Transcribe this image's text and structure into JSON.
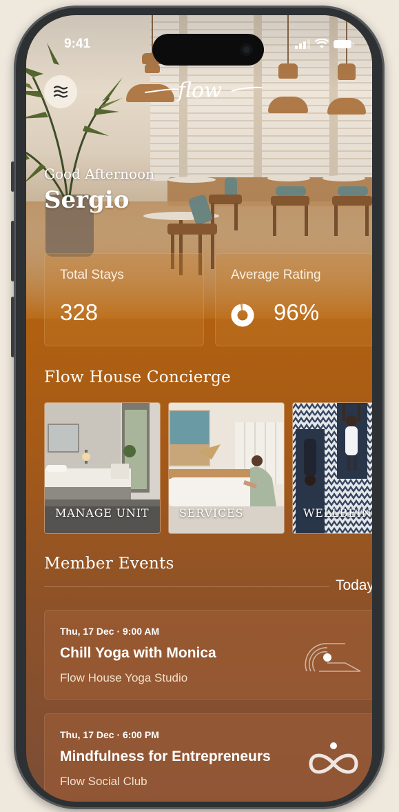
{
  "status_bar": {
    "time": "9:41"
  },
  "header": {
    "logo_text": "flow",
    "menu_icon": "menu-lines-icon"
  },
  "greeting": {
    "salutation": "Good Afternoon",
    "name": "Sergio"
  },
  "stats": {
    "total_stays_label": "Total Stays",
    "total_stays_value": "328",
    "avg_rating_label": "Average Rating",
    "avg_rating_value": "96%",
    "avg_rating_fraction": 0.96
  },
  "concierge": {
    "title": "Flow House Concierge",
    "cards": [
      {
        "label": "MANAGE UNIT"
      },
      {
        "label": "SERVICES"
      },
      {
        "label": "WELLBEING"
      }
    ]
  },
  "events": {
    "title": "Member Events",
    "filter": "Today",
    "items": [
      {
        "date": "Thu, 17 Dec · 9:00 AM",
        "title": "Chill Yoga with Monica",
        "venue": "Flow House Yoga Studio",
        "icon": "sunrise-icon"
      },
      {
        "date": "Thu, 17 Dec · 6:00 PM",
        "title": "Mindfulness for Entrepreneurs",
        "venue": "Flow Social Club",
        "icon": "infinity-icon"
      }
    ]
  }
}
